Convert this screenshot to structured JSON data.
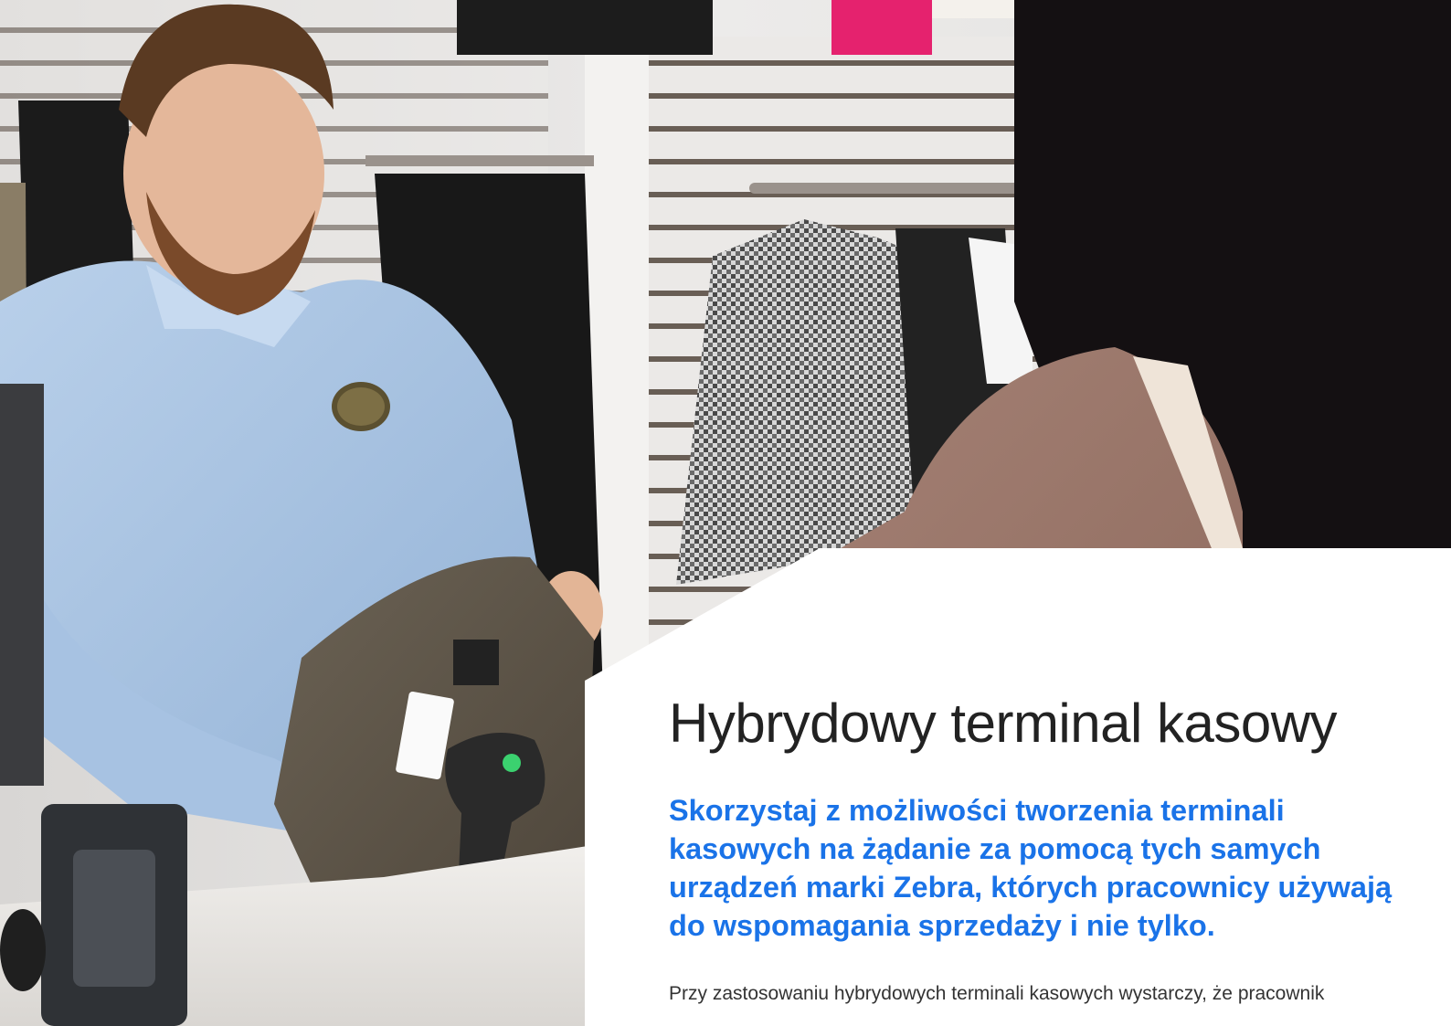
{
  "document": {
    "title": "Hybrydowy terminal kasowy",
    "subtitle": "Skorzystaj z możliwości tworzenia terminali kasowych na żądanie za pomocą tych samych urządzeń marki Zebra, których pracownicy używają do wspomagania sprzedaży i nie tylko.",
    "body_start": "Przy zastosowaniu hybrydowych terminali kasowych wystarczy, że pracownik"
  },
  "colors": {
    "accent": "#1a73e8",
    "title": "#222222",
    "body": "#333333"
  }
}
